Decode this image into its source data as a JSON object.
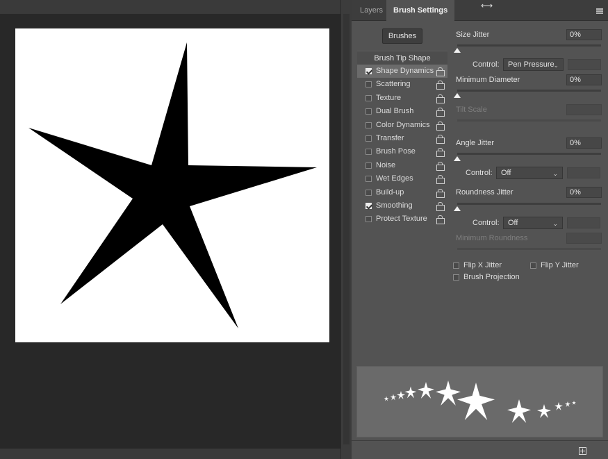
{
  "tabs": {
    "layers": "Layers",
    "brush_settings": "Brush Settings"
  },
  "brushes_button": "Brushes",
  "brush_tip_shape": "Brush Tip Shape",
  "options": [
    {
      "label": "Shape Dynamics",
      "checked": true,
      "selected": true
    },
    {
      "label": "Scattering",
      "checked": false
    },
    {
      "label": "Texture",
      "checked": false
    },
    {
      "label": "Dual Brush",
      "checked": false
    },
    {
      "label": "Color Dynamics",
      "checked": false
    },
    {
      "label": "Transfer",
      "checked": false
    },
    {
      "label": "Brush Pose",
      "checked": false
    },
    {
      "label": "Noise",
      "checked": false
    },
    {
      "label": "Wet Edges",
      "checked": false
    },
    {
      "label": "Build-up",
      "checked": false
    },
    {
      "label": "Smoothing",
      "checked": true
    },
    {
      "label": "Protect Texture",
      "checked": false
    }
  ],
  "settings": {
    "size_jitter": {
      "label": "Size Jitter",
      "value": "0%"
    },
    "control_label": "Control:",
    "control1": "Pen Pressure",
    "minimum_diameter": {
      "label": "Minimum Diameter",
      "value": "0%"
    },
    "tilt_scale": "Tilt Scale",
    "angle_jitter": {
      "label": "Angle Jitter",
      "value": "0%"
    },
    "control2": "Off",
    "roundness_jitter": {
      "label": "Roundness Jitter",
      "value": "0%"
    },
    "control3": "Off",
    "minimum_roundness": "Minimum Roundness",
    "flip_x": "Flip X Jitter",
    "flip_y": "Flip Y Jitter",
    "brush_projection": "Brush Projection"
  },
  "colors": {
    "panel_bg": "#535353",
    "workspace_bg": "#282828",
    "canvas_bg": "#ffffff"
  },
  "icons": {
    "lock": "lock-icon",
    "chevron": "chevron-down-icon",
    "new_preset": "new-brush-preset-icon"
  }
}
